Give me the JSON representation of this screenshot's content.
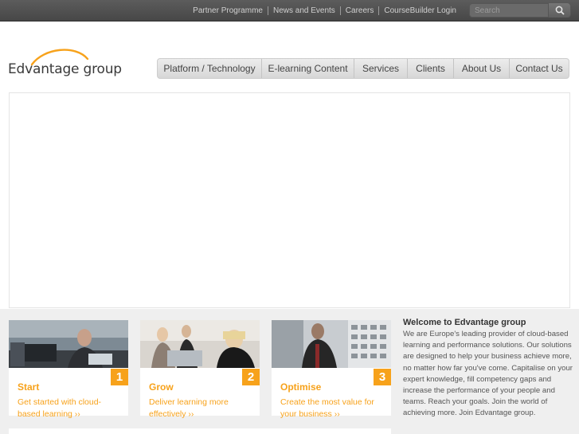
{
  "topbar": {
    "links": [
      "Partner Programme",
      "News and Events",
      "Careers",
      "CourseBuilder Login"
    ],
    "search_placeholder": "Search"
  },
  "logo": {
    "text": "Edvantage group"
  },
  "nav": {
    "items": [
      "Platform / Technology",
      "E-learning Content",
      "Services",
      "Clients",
      "About Us",
      "Contact Us"
    ]
  },
  "cards": [
    {
      "number": "1",
      "title": "Start",
      "desc": "Get started with cloud-based learning ››"
    },
    {
      "number": "2",
      "title": "Grow",
      "desc": "Deliver learning more effectively ››"
    },
    {
      "number": "3",
      "title": "Optimise",
      "desc": "Create the most value for your business ››"
    }
  ],
  "welcome": {
    "title": "Welcome to Edvantage group",
    "body": "We are Europe's leading provider of cloud-based learning and performance solutions. Our solutions are designed to help your business achieve more, no matter how far you've come. Capitalise on your expert knowledge, fill competency gaps and increase the performance of your people and teams. Reach your goals. Join the world of achieving more. Join Edvantage group."
  },
  "colors": {
    "accent": "#f7a21b",
    "topbar": "#4f4f4f",
    "nav_bg": "#e2e2e2"
  }
}
